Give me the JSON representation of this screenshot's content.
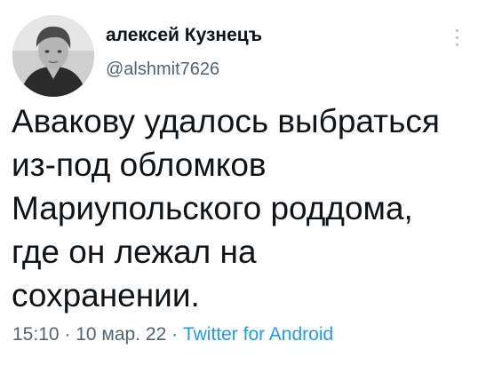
{
  "author": {
    "name": "алексей Кузнецъ",
    "handle": "@alshmit7626",
    "avatar_icon": "avatar-photo"
  },
  "more_icon": "more-vertical-icon",
  "tweet": {
    "text": "Авакову удалось выбраться\nиз-под обломков\nМариупольского роддома,\nгде он лежал на\nсохранении."
  },
  "meta": {
    "time": "15:10",
    "sep1": " · ",
    "date": "10 мар. 22",
    "sep2": " · ",
    "source": "Twitter for Android"
  },
  "colors": {
    "text": "#0f1419",
    "secondary": "#536471",
    "link": "#1d9bf0"
  }
}
